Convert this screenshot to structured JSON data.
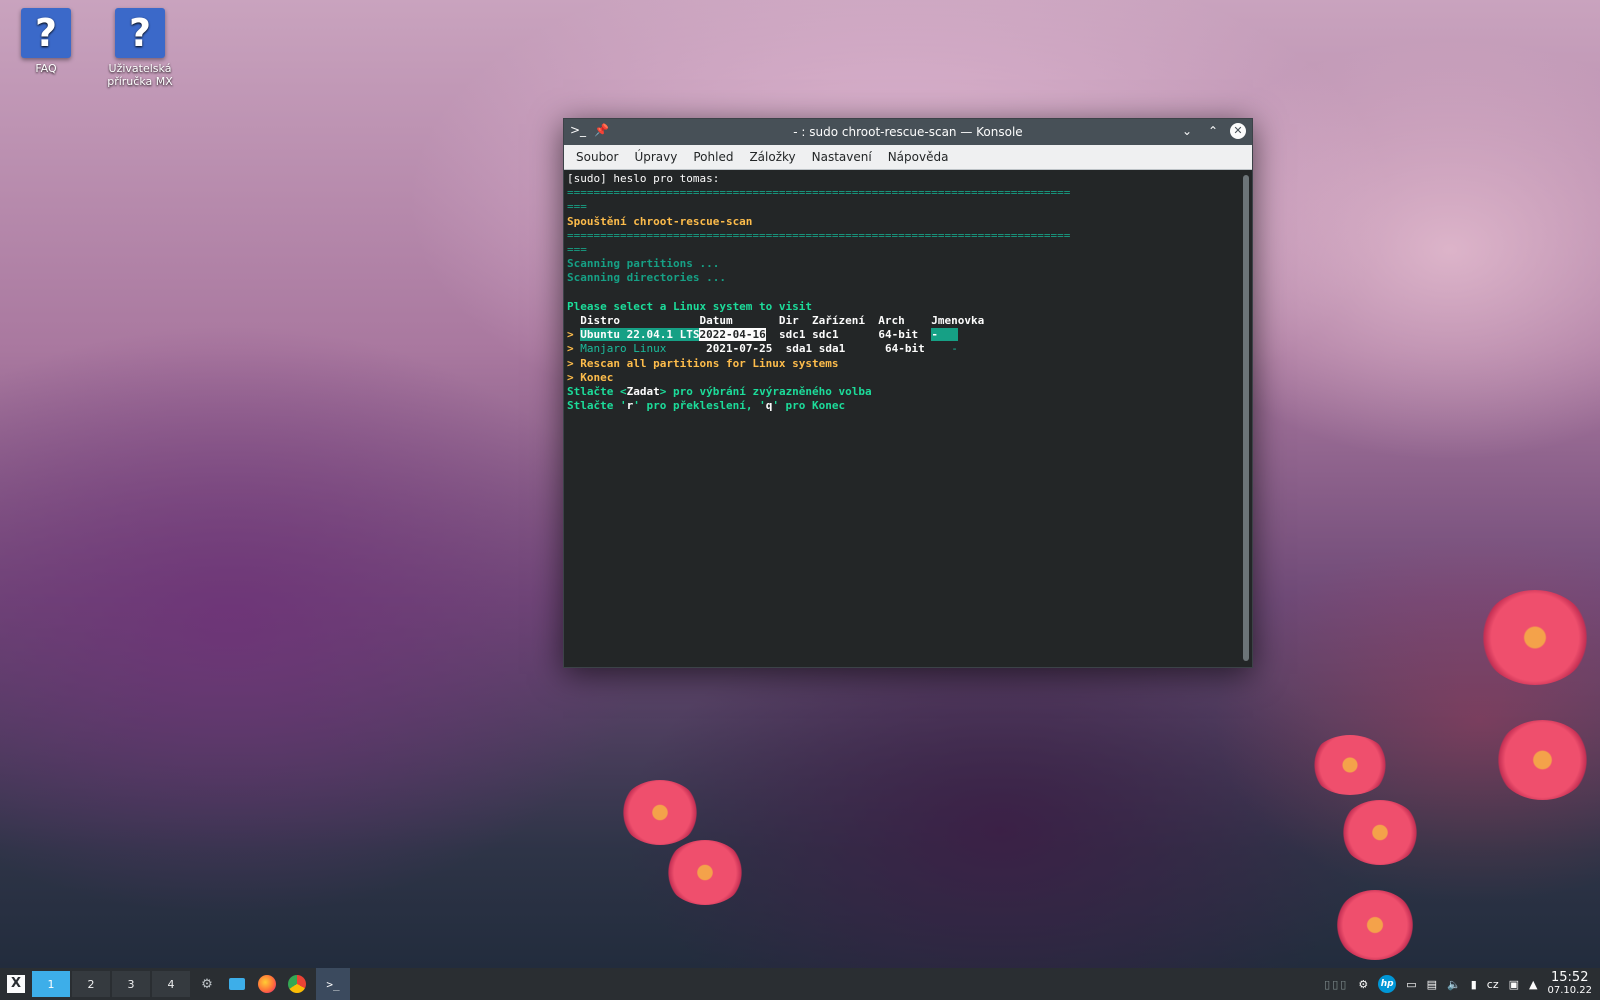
{
  "desktop": {
    "icons": [
      {
        "label": "FAQ",
        "glyph": "?"
      },
      {
        "label": "Uživatelská příručka MX",
        "glyph": "?"
      }
    ]
  },
  "window": {
    "title": "- : sudo chroot-rescue-scan — Konsole",
    "menu": [
      "Soubor",
      "Úpravy",
      "Pohled",
      "Záložky",
      "Nastavení",
      "Nápověda"
    ]
  },
  "terminal": {
    "prompt_line": "[sudo] heslo pro tomas:",
    "rule": "============================================================================",
    "rule_tail": "===",
    "heading": "Spouštění chroot-rescue-scan",
    "scan1": "Scanning partitions ...",
    "scan2": "Scanning directories ...",
    "select_prompt": "Please select a Linux system to visit",
    "table_header": "  Distro            Datum       Dir  Zařízení  Arch    Jmenovka",
    "row1": {
      "marker": "> ",
      "distro": "Ubuntu 22.04.1 LTS",
      "datum": "2022-04-16",
      "dir": "sdc1",
      "device": "sdc1",
      "arch": "64-bit",
      "label": "-"
    },
    "row2": {
      "marker": "> ",
      "distro": "Manjaro Linux",
      "datum": "2021-07-25",
      "dir": "sda1",
      "device": "sda1",
      "arch": "64-bit",
      "label": "-"
    },
    "option_rescan": "> Rescan all partitions for Linux systems",
    "option_quit": "> Konec",
    "hint1_pre": "Stlačte <",
    "hint1_key": "Zadat",
    "hint1_post": "> pro výbrání zvýrazněného volba",
    "hint2_pre": "Stlačte '",
    "hint2_r": "r",
    "hint2_mid": "' pro překleslení, '",
    "hint2_q": "q",
    "hint2_post": "' pro Konec"
  },
  "taskbar": {
    "desktops": [
      "1",
      "2",
      "3",
      "4"
    ],
    "active_desktop": "1",
    "keyboard_layout": "cz",
    "time": "15:52",
    "date": "07.10.22"
  },
  "colors": {
    "accent": "#3daee9",
    "terminal_bg": "#232627",
    "teal": "#16a085",
    "orange": "#fdbc4b"
  }
}
